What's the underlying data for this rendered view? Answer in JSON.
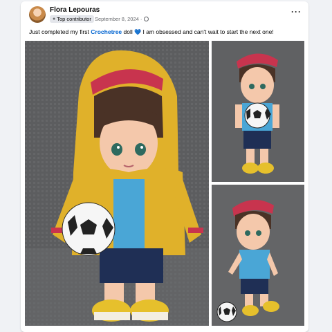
{
  "post": {
    "author": "Flora Lepouras",
    "badge": "Top contributor",
    "date": "September 8, 2024 ·",
    "more_icon": "more-dots-icon",
    "caption_before": "Just completed my first ",
    "caption_link": "Crochetree",
    "caption_middle": " doll ",
    "caption_after": " I am obsessed and can't wait to start the next one!",
    "heart": "💙"
  },
  "colors": {
    "link": "#0064d1",
    "heart": "#2e8ef5",
    "background": "#f0f2f5",
    "jacket": "#e0b12a",
    "shirt": "#4aa6d6",
    "shorts": "#1f2f55"
  }
}
